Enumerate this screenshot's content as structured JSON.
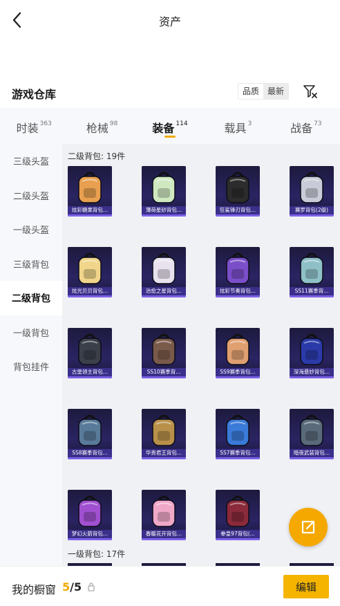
{
  "header": {
    "title": "资产",
    "back_icon": "chevron-left-icon"
  },
  "section": {
    "title": "游戏仓库",
    "sort_options": [
      "品质",
      "最新"
    ],
    "filter_icon": "filter-icon"
  },
  "tabs": [
    {
      "label": "时装",
      "count": "363"
    },
    {
      "label": "枪械",
      "count": "98"
    },
    {
      "label": "装备",
      "count": "114",
      "active": true
    },
    {
      "label": "载具",
      "count": "3"
    },
    {
      "label": "战备",
      "count": "73"
    }
  ],
  "sidebar": {
    "items": [
      {
        "label": "三级头盔"
      },
      {
        "label": "二级头盔"
      },
      {
        "label": "一级头盔"
      },
      {
        "label": "三级背包"
      },
      {
        "label": "二级背包",
        "active": true
      },
      {
        "label": "一级背包"
      },
      {
        "label": "背包挂件"
      }
    ]
  },
  "groups": [
    {
      "label": "二级背包: 19件"
    },
    {
      "label": "一级背包: 17件"
    }
  ],
  "items": [
    {
      "label": "炫彩糖果背包...",
      "color": "#e8a050"
    },
    {
      "label": "薄荷星砂背包...",
      "color": "#cfe8c0"
    },
    {
      "label": "狂鲨锋刃背包...",
      "color": "#2c2c2c"
    },
    {
      "label": "赛罗背包(2级)",
      "color": "#c9ccd8"
    },
    {
      "label": "炫光贝贝背包...",
      "color": "#f0d58a"
    },
    {
      "label": "治愈之星背包...",
      "color": "#e8e2ee"
    },
    {
      "label": "炫彩节奏背包...",
      "color": "#7a4ec9"
    },
    {
      "label": "SS11赛季背...",
      "color": "#8fc0c8"
    },
    {
      "label": "古堡领主背包...",
      "color": "#3a3f4a"
    },
    {
      "label": "SS10赛季背...",
      "color": "#7a5a4a"
    },
    {
      "label": "SS9赛季背包...",
      "color": "#e0a070"
    },
    {
      "label": "深海悬妙背包...",
      "color": "#2a3aa8"
    },
    {
      "label": "SS8赛季背包...",
      "color": "#5a7a9a"
    },
    {
      "label": "华贵君王背包...",
      "color": "#b8904a"
    },
    {
      "label": "SS7赛季背包...",
      "color": "#3a7ad8"
    },
    {
      "label": "暗夜武装背包...",
      "color": "#5a6a7a"
    },
    {
      "label": "梦幻火箭背包...",
      "color": "#a050d0"
    },
    {
      "label": "春暖花开背包...",
      "color": "#f0a8c8"
    },
    {
      "label": "拳皇97背包(...",
      "color": "#8a2a3a"
    }
  ],
  "fab_icon": "external-link-icon",
  "bottom": {
    "label": "我的橱窗",
    "current": "5",
    "total": "/5",
    "lock_icon": "lock-icon",
    "edit_label": "编辑"
  },
  "colors": {
    "accent": "#f4b400",
    "item_bg": "#231f4e",
    "item_label": "#3a2f8a"
  }
}
